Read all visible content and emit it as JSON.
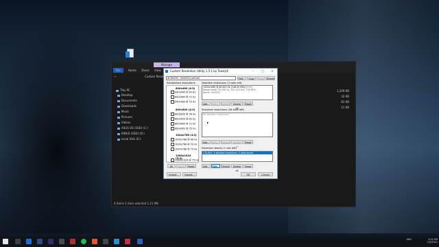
{
  "explorer": {
    "ribbon_tabs": [
      "File",
      "Home",
      "Share",
      "View"
    ],
    "manage_tab": "Manage",
    "address_text": "Custom Resolution",
    "sidebar": [
      {
        "label": "This PC"
      },
      {
        "label": "Desktop"
      },
      {
        "label": "Documents"
      },
      {
        "label": "Downloads"
      },
      {
        "label": "Music"
      },
      {
        "label": "Pictures"
      },
      {
        "label": "Videos"
      },
      {
        "label": "ASUS OS (SSD) (C:)"
      },
      {
        "label": "KINGS (SSD) (D:)"
      },
      {
        "label": "Local Disk (E:)"
      }
    ],
    "sizes": [
      "1,249 KB",
      "32 KB",
      "83 KB",
      "11 KB"
    ],
    "status": "4 items   1 item selected  1.21 MB"
  },
  "cru": {
    "title": "Custom Resolution Utility 1.5.1 by ToastyX",
    "monitor_select": "ACR0339 - VG252Q (active)",
    "top_buttons": [
      "Edit...",
      "Copy",
      "Paste",
      "Delete"
    ],
    "established_label": "Established resolutions",
    "groups": [
      {
        "header": "640x480 (4:3)",
        "items": [
          "640x480 @ 60 Hz",
          "640x480 @ 72 Hz",
          "640x480 @ 75 Hz"
        ]
      },
      {
        "header": "800x600 (4:3)",
        "items": [
          "800x600 @ 56 Hz",
          "800x600 @ 60 Hz",
          "800x600 @ 72 Hz",
          "800x600 @ 75 Hz"
        ]
      },
      {
        "header": "1024x768 (4:3)",
        "items": [
          "1024x768 @ 60 Hz",
          "1024x768 @ 70 Hz",
          "1024x768 @ 75 Hz"
        ]
      },
      {
        "header": "1280x1024 (5:4)",
        "items": [
          "1280x1024 @ 75 Hz"
        ]
      }
    ],
    "est_buttons": [
      "All",
      "None",
      "Reset"
    ],
    "detailed_label": "Detailed resolutions (3 slots left)",
    "detailed_items": [
      "1920x1080 @ 60.000 Hz [148.50 MHz] (+/+)",
      "Range limits: 55-240 Hz, 255-255 kHz, 250 MHz",
      "Name: VG252Q"
    ],
    "standard_label": "Standard resolutions (26 slots left)",
    "standard_items": [
      "No standard resolutions"
    ],
    "extension_label": "Extension blocks (1 slot left)",
    "extension_items": [
      "CTA-861: 5 detailed resolutions, 5 data blocks"
    ],
    "list_buttons": [
      "Add...",
      "Edit...",
      "Delete",
      "Delete all",
      "Reset"
    ],
    "ext_buttons": [
      "Add...",
      "Edit...",
      "Delete",
      "Delete all",
      "Reset"
    ],
    "bottom_buttons": {
      "import": "Import...",
      "export": "Export...",
      "ok": "OK",
      "cancel": "Cancel"
    }
  },
  "tray": {
    "lang": "ENG",
    "time": "5:21 PM",
    "date": "1/9/2021"
  }
}
